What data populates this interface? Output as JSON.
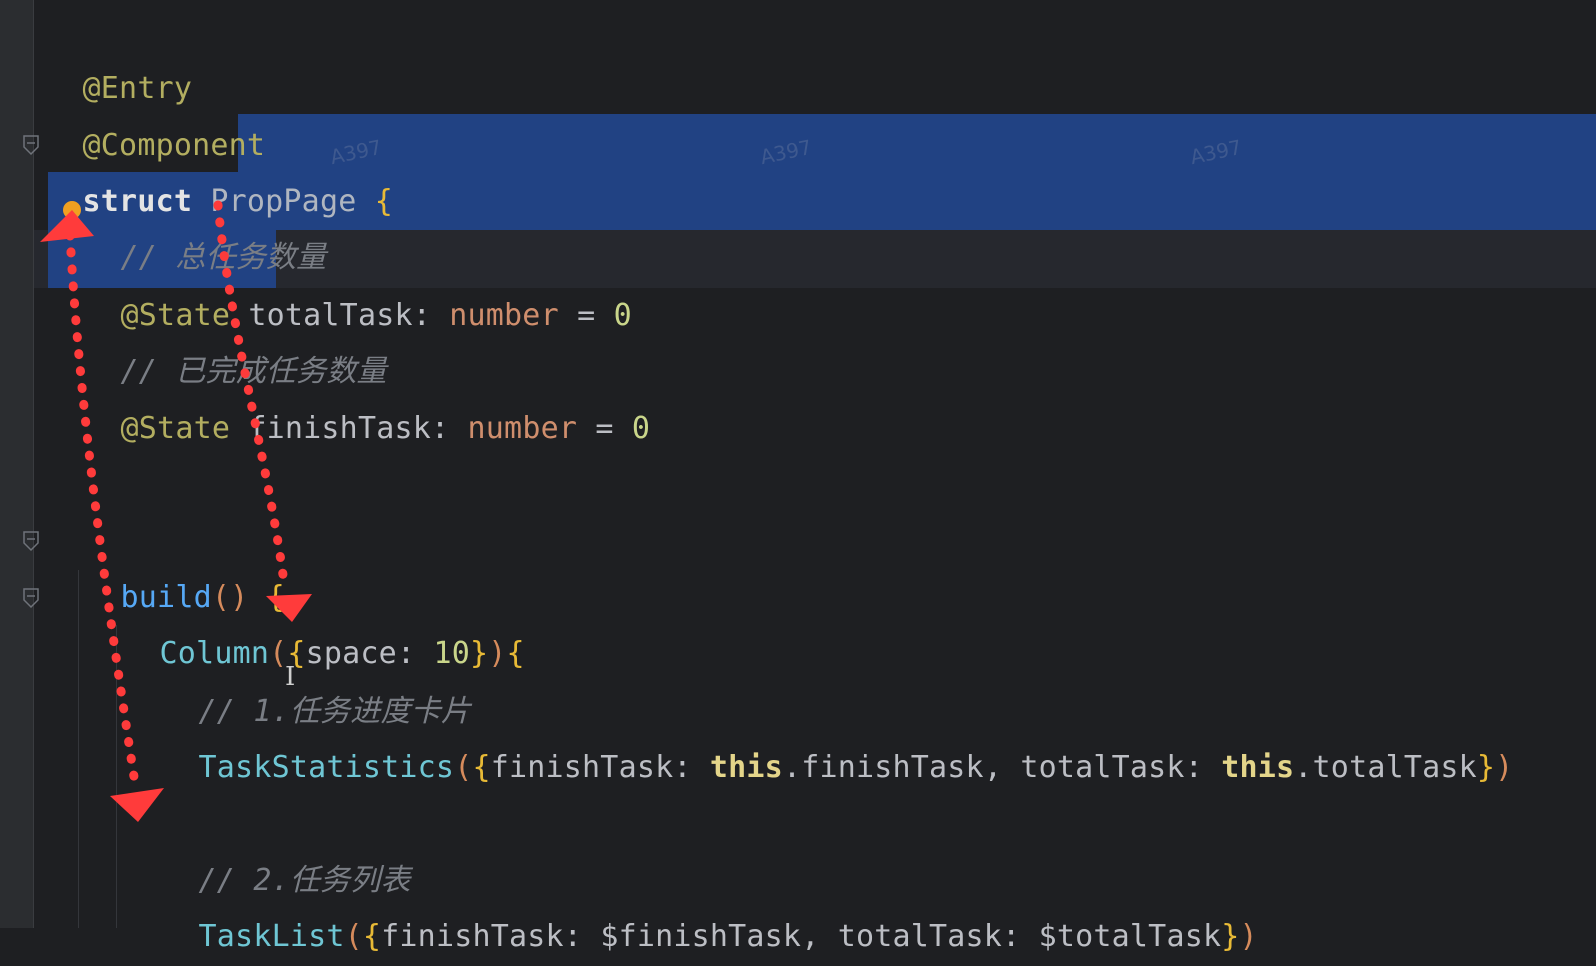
{
  "editor": {
    "lines": {
      "l1": {
        "decorator": "@Entry"
      },
      "l2": {
        "decorator": "@Component"
      },
      "l3": {
        "keyword": "struct",
        "name": "PropPage",
        "open": "{"
      },
      "l4": {
        "comment": "// 总任务数量"
      },
      "l5": {
        "decorator": "@State",
        "var": "totalTask",
        "colon": ":",
        "type": "number",
        "assign": "=",
        "value": "0"
      },
      "l6": {
        "comment": "// 已完成任务数量"
      },
      "l7": {
        "decorator": "@State",
        "var": "finishTask",
        "colon": ":",
        "type": "number",
        "assign": "=",
        "value": "0"
      },
      "l8": {
        "fn": "build",
        "parens": "()",
        "open": "{"
      },
      "l9": {
        "component": "Column",
        "paren_open": "(",
        "brace_open": "{",
        "key": "space",
        "colon": ":",
        "value": "10",
        "brace_close": "}",
        "paren_close": ")",
        "open": "{"
      },
      "l10": {
        "comment": "// 1.任务进度卡片"
      },
      "l11": {
        "component": "TaskStatistics",
        "paren_open": "(",
        "brace_open": "{",
        "k1": "finishTask",
        "c1": ":",
        "this1": "this",
        "v1": ".finishTask,",
        "k2": "totalTask",
        "c2": ":",
        "this2": "this",
        "v2": ".totalTask",
        "brace_close": "}",
        "paren_close": ")"
      },
      "l12": {
        "comment": "// 2.任务列表"
      },
      "l13": {
        "component": "TaskList",
        "paren_open": "(",
        "brace_open": "{",
        "k1": "finishTask",
        "c1": ":",
        "v1": "$finishTask,",
        "k2": "totalTask",
        "c2": ":",
        "v2": "$totalTask",
        "brace_close": "}",
        "paren_close": ")"
      }
    },
    "watermark": "A397"
  },
  "colors": {
    "background": "#1e1f22",
    "selection": "#214283",
    "arrow": "#ff3b3b"
  },
  "icons": [
    "fold-icon",
    "breakpoint-dot-icon",
    "ibeam-cursor-icon"
  ]
}
